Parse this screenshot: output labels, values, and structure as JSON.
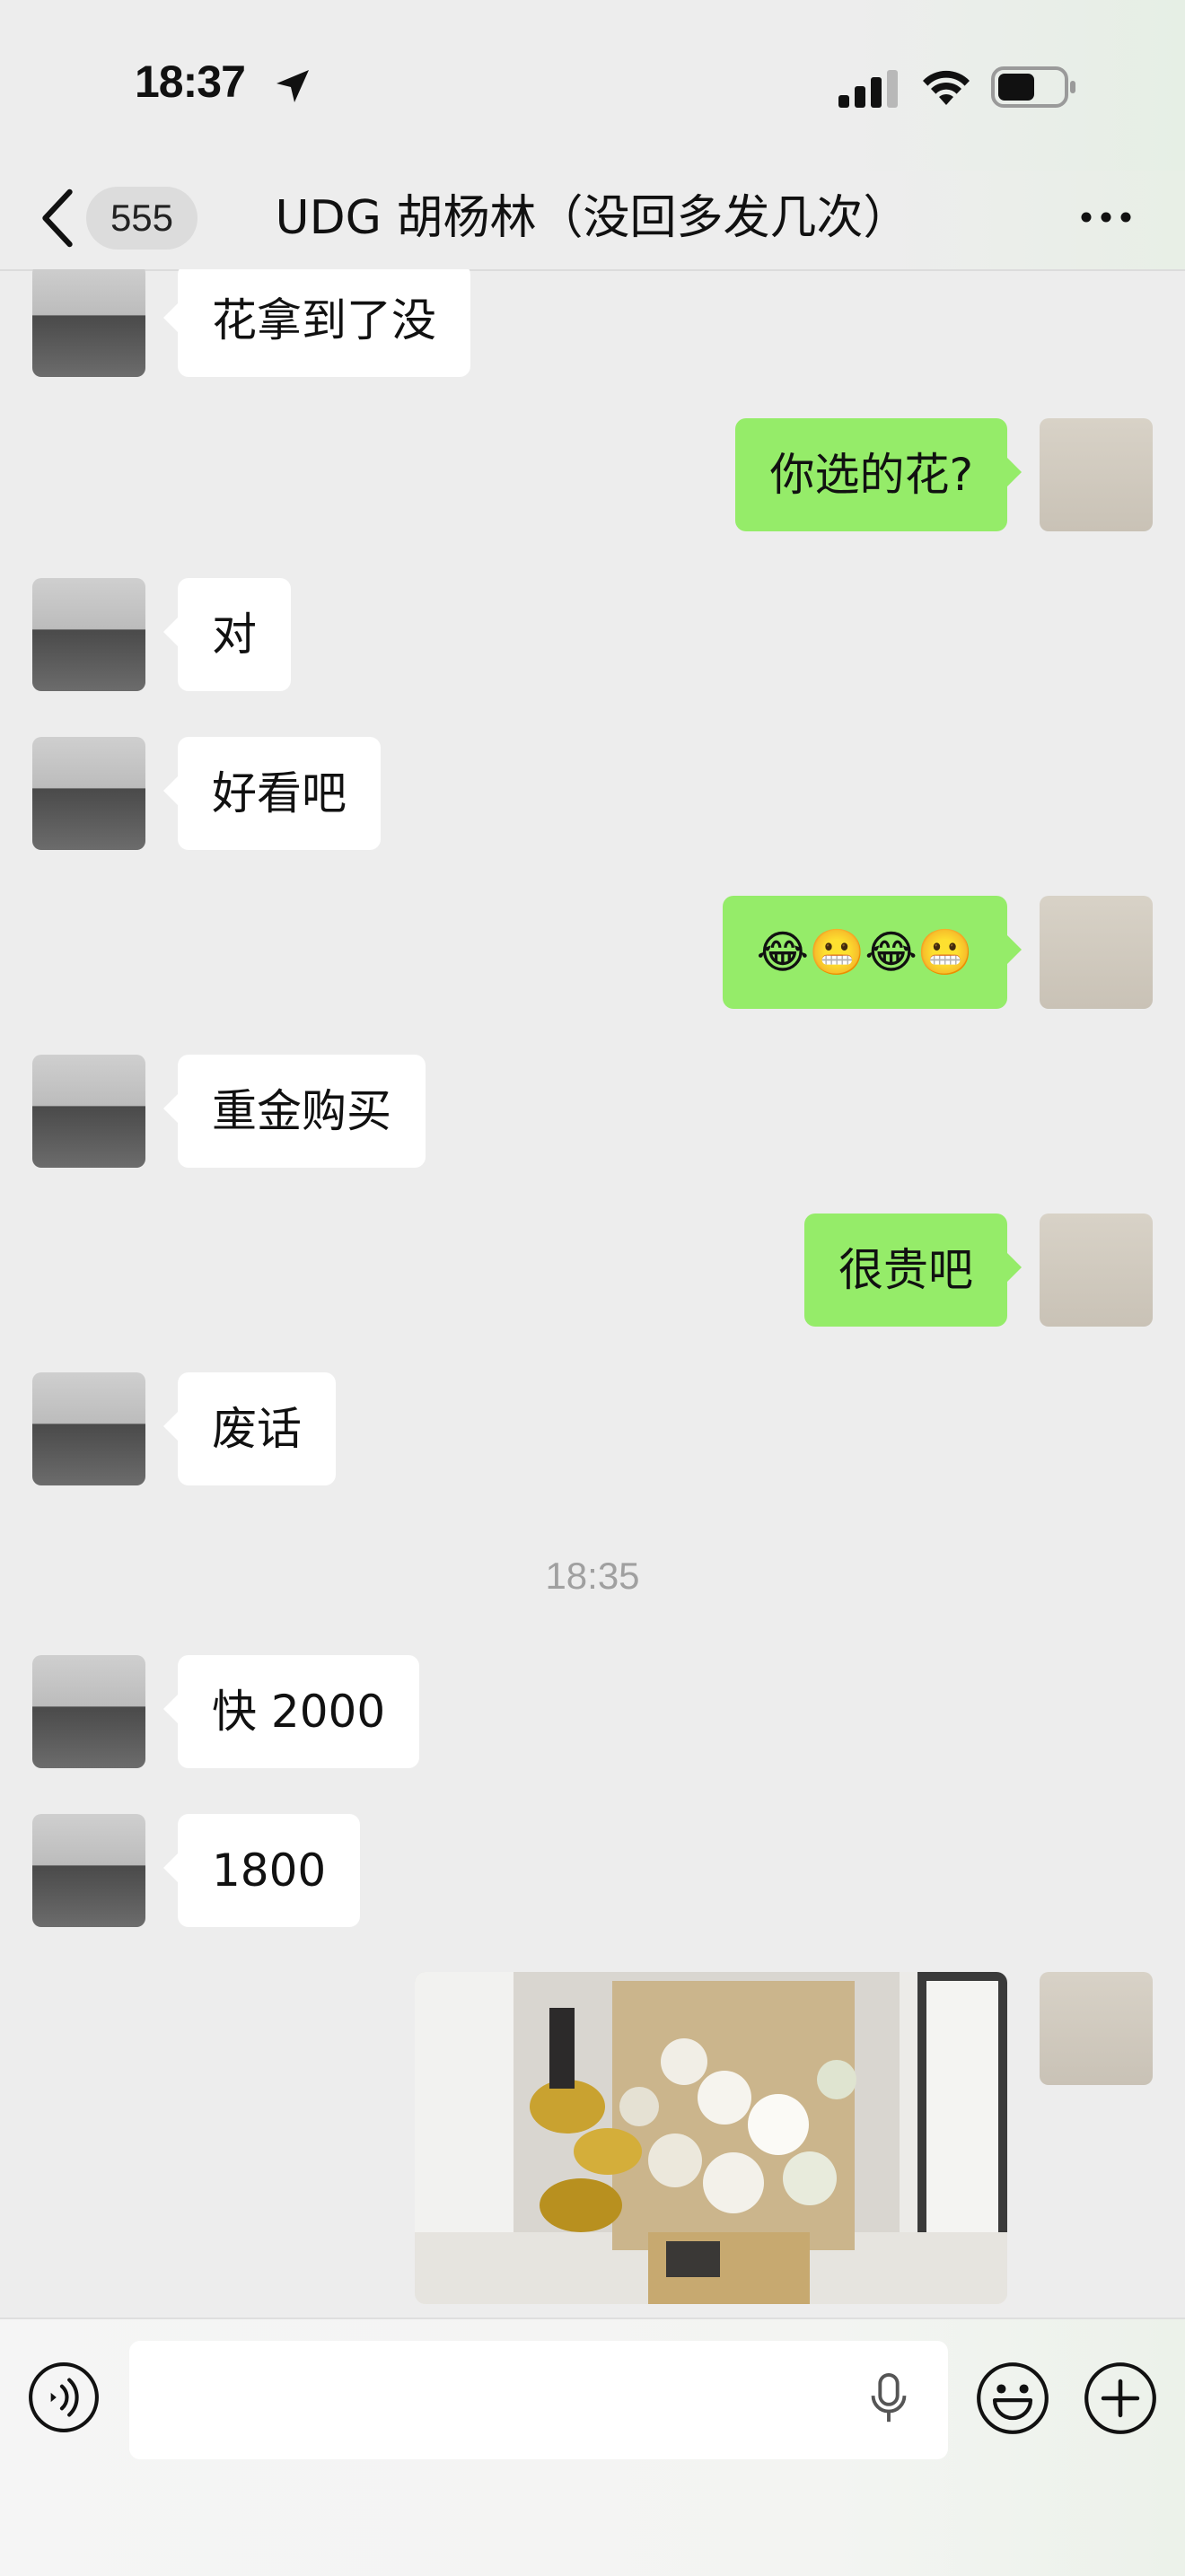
{
  "status_bar": {
    "time": "18:37",
    "icons": [
      "location-arrow-icon",
      "cellular-signal-icon",
      "wifi-icon",
      "battery-icon"
    ]
  },
  "nav": {
    "back_icon": "chevron-left-icon",
    "unread_count": "555",
    "title": "UDG 胡杨林（没回多发几次）",
    "more_icon": "ellipsis-icon"
  },
  "messages": [
    {
      "side": "left",
      "text": "花拿到了没"
    },
    {
      "side": "right",
      "text": "你选的花?"
    },
    {
      "side": "left",
      "text": "对"
    },
    {
      "side": "left",
      "text": "好看吧"
    },
    {
      "side": "right",
      "text": "😂😬😂😬"
    },
    {
      "side": "left",
      "text": "重金购买"
    },
    {
      "side": "right",
      "text": "很贵吧"
    },
    {
      "side": "left",
      "text": "废话"
    },
    {
      "side": "left",
      "text": "快 2000"
    },
    {
      "side": "left",
      "text": "1800"
    },
    {
      "side": "right",
      "type": "image",
      "image": "flower-bouquet-photo"
    }
  ],
  "timestamp": "18:35",
  "input_bar": {
    "value": "",
    "icons": [
      "voice-icon",
      "microphone-icon",
      "emoji-icon",
      "plus-icon"
    ]
  },
  "colors": {
    "background": "#ededed",
    "incoming_bubble": "#ffffff",
    "outgoing_bubble": "#95ec69",
    "timestamp": "#a0a0a0"
  }
}
